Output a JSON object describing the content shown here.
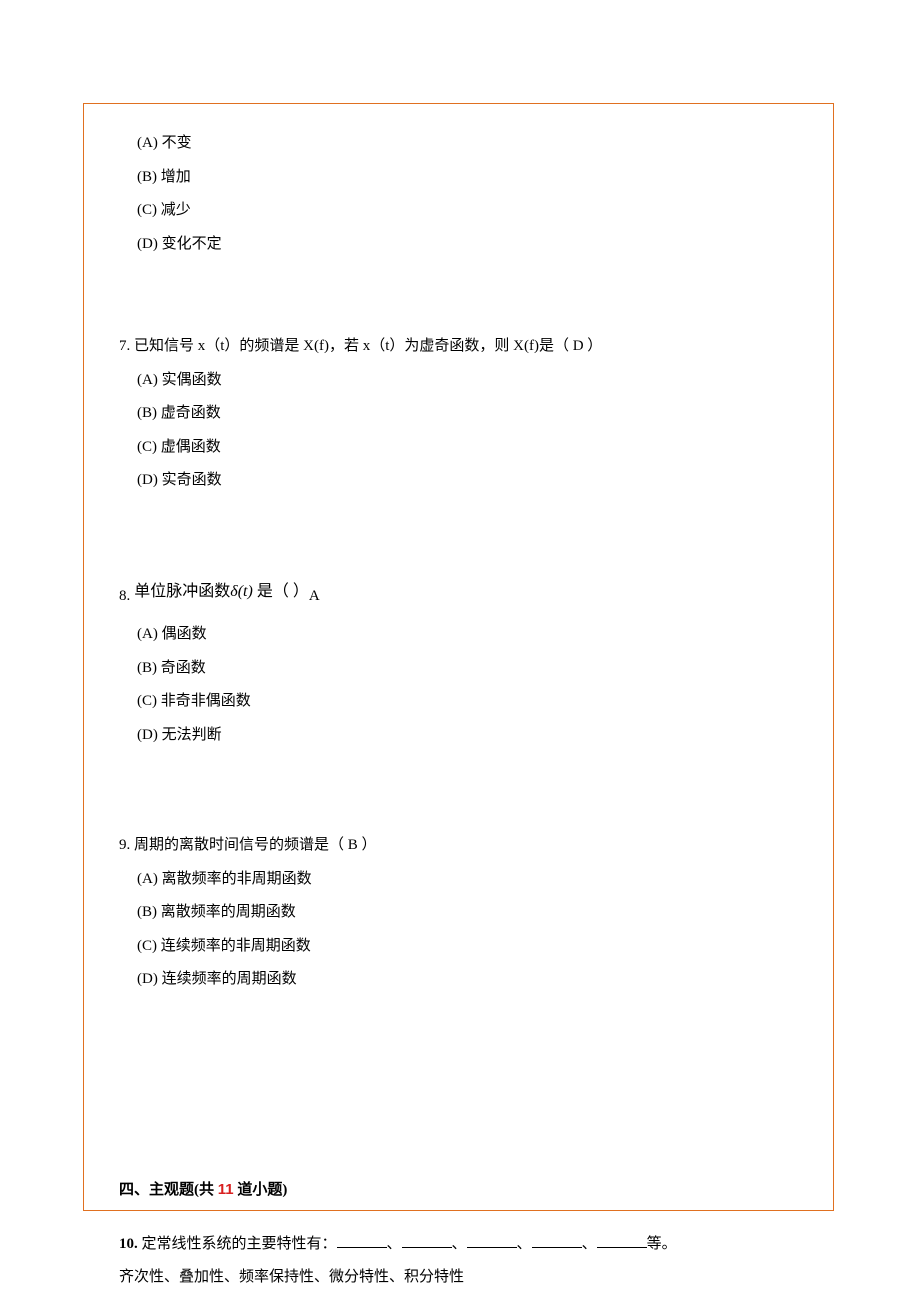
{
  "q6_continued": {
    "options": {
      "a": "(A) 不变",
      "b": "(B) 增加",
      "c": "(C) 减少",
      "d": "(D) 变化不定"
    }
  },
  "q7": {
    "stem": "7.  已知信号 x（t）的频谱是 X(f)，若 x（t）为虚奇函数，则 X(f)是（    D        ）",
    "options": {
      "a": "(A) 实偶函数",
      "b": "(B) 虚奇函数",
      "c": "(C) 虚偶函数",
      "d": "(D) 实奇函数"
    }
  },
  "q8": {
    "num": "8.",
    "part1": " 单位脉冲函数",
    "delta": "δ(t)",
    "part2": " 是（                    ）",
    "answer_mark": "A",
    "options": {
      "a": "(A) 偶函数",
      "b": "(B) 奇函数",
      "c": "(C) 非奇非偶函数",
      "d": "(D) 无法判断"
    }
  },
  "q9": {
    "stem": "9.  周期的离散时间信号的频谱是（      B        ）",
    "options": {
      "a": "(A) 离散频率的非周期函数",
      "b": "(B) 离散频率的周期函数",
      "c": "(C) 连续频率的非周期函数",
      "d": "(D) 连续频率的周期函数"
    }
  },
  "section4": {
    "prefix": "四、主观题(共 ",
    "count": "11",
    "suffix": " 道小题)"
  },
  "q10": {
    "label": "10. ",
    "stem_start": "定常线性系统的主要特性有：",
    "sep": "、",
    "end": "等。",
    "answer": "齐次性、叠加性、频率保持性、微分特性、积分特性"
  }
}
